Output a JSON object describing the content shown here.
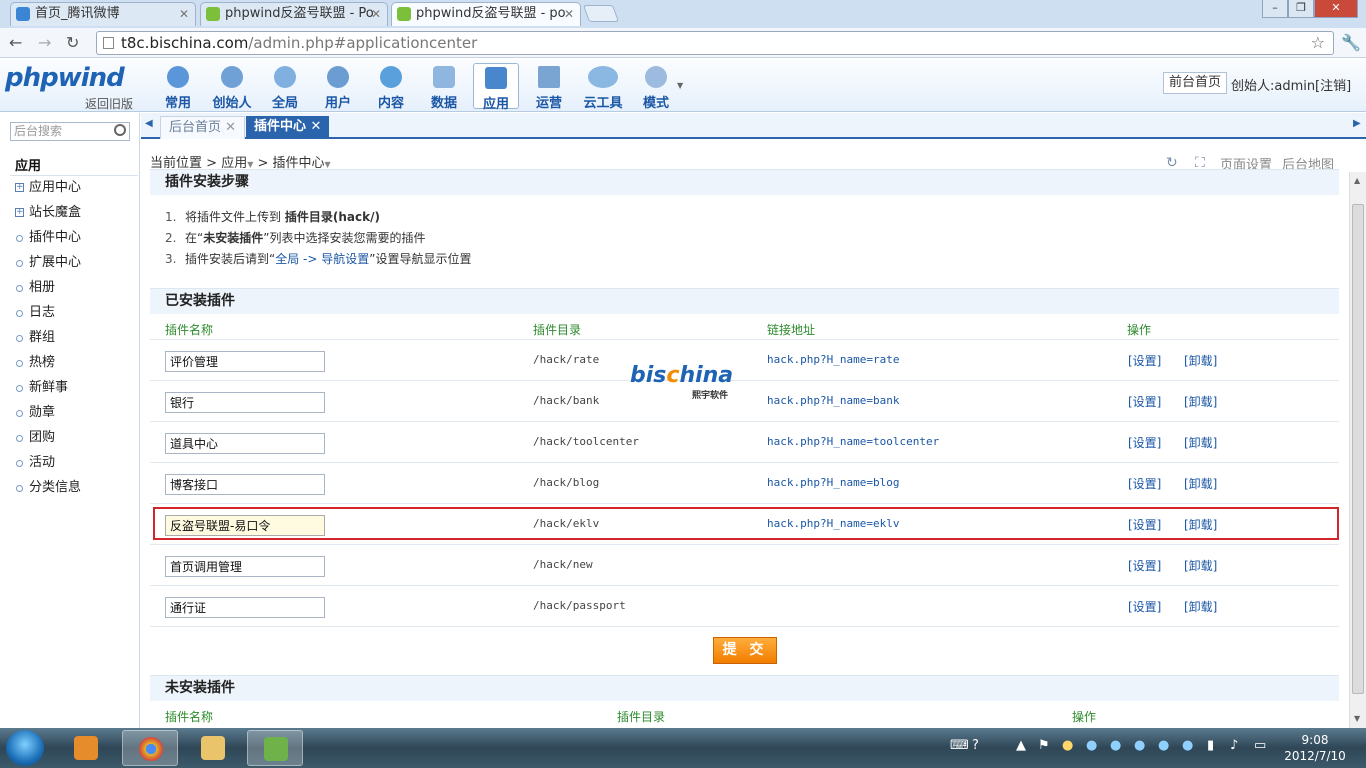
{
  "browser": {
    "tabs": [
      {
        "title": "首页_腾讯微博"
      },
      {
        "title": "phpwind反盗号联盟 - Po"
      },
      {
        "title": "phpwind反盗号联盟 - po"
      }
    ],
    "url_host": "t8c.bischina.com",
    "url_path": "/admin.php#applicationcenter"
  },
  "header": {
    "logo": "phpwind",
    "back_old": "返回旧版",
    "nav": [
      {
        "label": "常用"
      },
      {
        "label": "创始人"
      },
      {
        "label": "全局"
      },
      {
        "label": "用户"
      },
      {
        "label": "内容"
      },
      {
        "label": "数据"
      },
      {
        "label": "应用"
      },
      {
        "label": "运营"
      },
      {
        "label": "云工具"
      },
      {
        "label": "模式"
      }
    ],
    "front_home": "前台首页",
    "founder": "创始人:admin",
    "logout": "[注销]"
  },
  "sidebar": {
    "search_placeholder": "后台搜索",
    "heading": "应用",
    "items": [
      {
        "label": "应用中心"
      },
      {
        "label": "站长魔盒"
      },
      {
        "label": "插件中心"
      },
      {
        "label": "扩展中心"
      },
      {
        "label": "相册"
      },
      {
        "label": "日志"
      },
      {
        "label": "群组"
      },
      {
        "label": "热榜"
      },
      {
        "label": "新鲜事"
      },
      {
        "label": "勋章"
      },
      {
        "label": "团购"
      },
      {
        "label": "活动"
      },
      {
        "label": "分类信息"
      }
    ]
  },
  "content_tabs": [
    {
      "label": "后台首页"
    },
    {
      "label": "插件中心"
    }
  ],
  "breadcrumb": {
    "current": "当前位置",
    "level1": "应用",
    "level2": "插件中心"
  },
  "page_tools": {
    "page_settings": "页面设置",
    "site_map": "后台地图"
  },
  "install_steps": {
    "title": "插件安装步骤",
    "steps": [
      {
        "num": "1.",
        "pre": "将插件文件上传到",
        "bold": "插件目录(hack/)",
        "post": ""
      },
      {
        "num": "2.",
        "pre": "在“",
        "bold": "未安装插件",
        "post": "”列表中选择安装您需要的插件"
      },
      {
        "num": "3.",
        "pre": "插件安装后请到“",
        "bold": "全局 -> 导航设置",
        "post": "”设置导航显示位置"
      }
    ]
  },
  "installed": {
    "title": "已安装插件",
    "headers": {
      "name": "插件名称",
      "dir": "插件目录",
      "link": "链接地址",
      "op": "操作"
    },
    "rows": [
      {
        "name": "评价管理",
        "dir": "/hack/rate",
        "link": "hack.php?H_name=rate"
      },
      {
        "name": "银行",
        "dir": "/hack/bank",
        "link": "hack.php?H_name=bank"
      },
      {
        "name": "道具中心",
        "dir": "/hack/toolcenter",
        "link": "hack.php?H_name=toolcenter"
      },
      {
        "name": "博客接口",
        "dir": "/hack/blog",
        "link": "hack.php?H_name=blog"
      },
      {
        "name": "反盗号联盟-易口令",
        "dir": "/hack/eklv",
        "link": "hack.php?H_name=eklv"
      },
      {
        "name": "首页调用管理",
        "dir": "/hack/new",
        "link": ""
      },
      {
        "name": "通行证",
        "dir": "/hack/passport",
        "link": ""
      }
    ],
    "op_settings": "[设置]",
    "op_uninstall": "[卸载]",
    "submit": "提 交"
  },
  "uninstalled": {
    "title": "未安装插件",
    "headers": {
      "name": "插件名称",
      "dir": "插件目录",
      "op": "操作"
    }
  },
  "watermark": {
    "main": "bischina",
    "sub": "熙宇软件"
  },
  "taskbar": {
    "time": "9:08",
    "date": "2012/7/10"
  }
}
